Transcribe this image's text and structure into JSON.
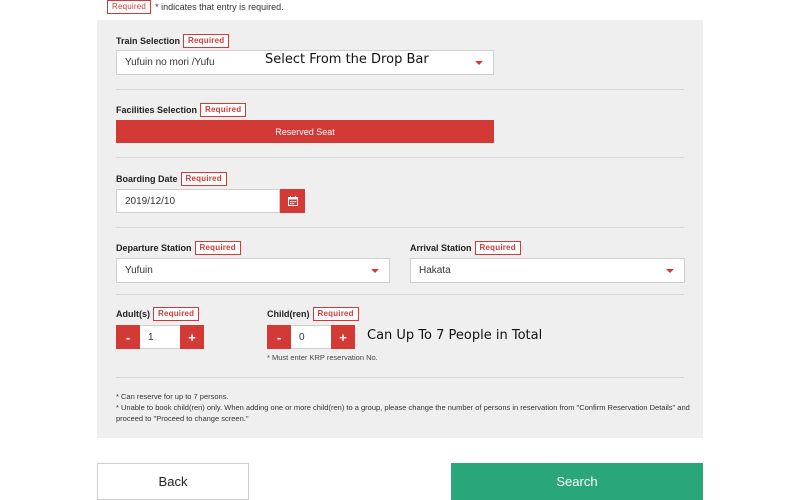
{
  "legend": {
    "badge": "Required",
    "text": "* indicates that entry is required."
  },
  "train": {
    "label": "Train Selection",
    "badge": "Required",
    "value": "Yufuin no mori /Yufu",
    "overlay": "Select From the Drop Bar"
  },
  "facilities": {
    "label": "Facilities Selection",
    "badge": "Required",
    "value": "Reserved Seat"
  },
  "boarding": {
    "label": "Boarding Date",
    "badge": "Required",
    "value": "2019/12/10"
  },
  "departure": {
    "label": "Departure Station",
    "badge": "Required",
    "value": "Yufuin"
  },
  "arrival": {
    "label": "Arrival Station",
    "badge": "Required",
    "value": "Hakata"
  },
  "adults": {
    "label": "Adult(s)",
    "badge": "Required",
    "minus": "-",
    "value": "1",
    "plus": "+"
  },
  "children": {
    "label": "Child(ren)",
    "badge": "Required",
    "minus": "-",
    "value": "0",
    "plus": "+",
    "note": "* Must enter KRP reservation No."
  },
  "people_overlay": "Can Up To 7 People in Total",
  "notes": [
    "* Can reserve for up to 7 persons.",
    "* Unable to book child(ren) only. When adding one or more child(ren) to a group, please change the number of persons in reservation from \"Confirm Reservation Details\" and proceed to \"Proceed to change screen.\""
  ],
  "buttons": {
    "back": "Back",
    "search": "Search"
  },
  "colors": {
    "accent": "#d33a36",
    "search": "#2aa77a",
    "panel": "#efefef"
  },
  "icons": {
    "calendar": "calendar-icon",
    "caret": "chevron-down-icon"
  }
}
